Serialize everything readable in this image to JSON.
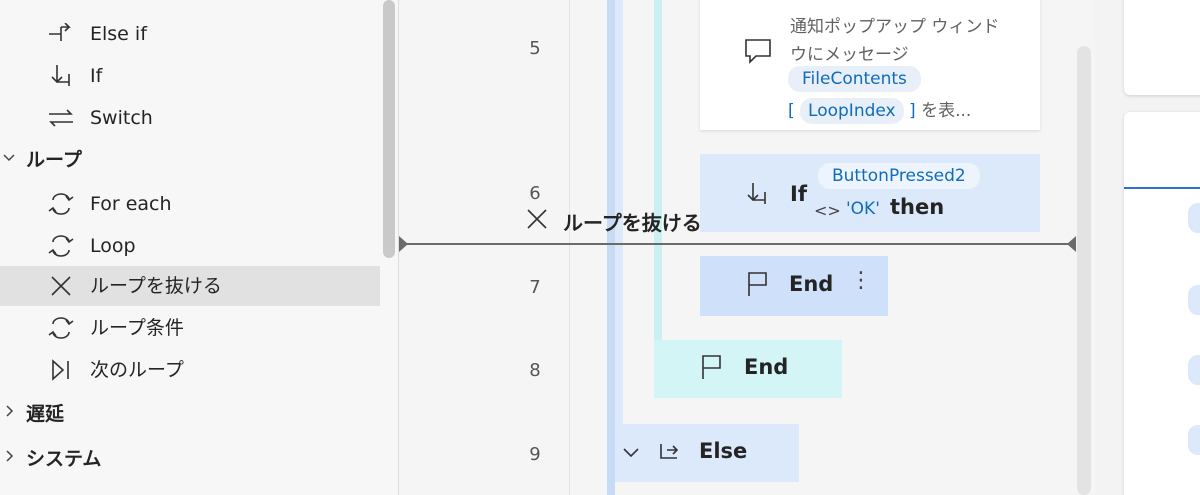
{
  "actions_panel": {
    "items": [
      {
        "label": "Else if",
        "icon": "else-if-icon"
      },
      {
        "label": "If",
        "icon": "if-icon"
      },
      {
        "label": "Switch",
        "icon": "switch-icon"
      }
    ],
    "groups": [
      {
        "label": "ループ",
        "expanded": true
      },
      {
        "label": "遅延",
        "expanded": false
      },
      {
        "label": "システム",
        "expanded": false
      }
    ],
    "loop_items": [
      {
        "label": "For each",
        "icon": "for-each-icon"
      },
      {
        "label": "Loop",
        "icon": "loop-icon"
      },
      {
        "label": "ループを抜ける",
        "icon": "exit-loop-icon",
        "selected": true
      },
      {
        "label": "ループ条件",
        "icon": "loop-condition-icon"
      },
      {
        "label": "次のループ",
        "icon": "next-loop-icon"
      }
    ]
  },
  "flow": {
    "line_numbers": [
      "5",
      "6",
      "7",
      "8",
      "9"
    ],
    "steps": {
      "message": {
        "line1": "通知ポップアップ ウィンド",
        "line2": "ウにメッセージ",
        "token1": "FileContents",
        "bracket_open": "[",
        "token2": "LoopIndex",
        "bracket_close": "]",
        "suffix": "を表..."
      },
      "if": {
        "keyword": "If",
        "var": "ButtonPressed2",
        "operator": "<>",
        "value": "'OK'",
        "then": "then"
      },
      "end_inner": {
        "keyword": "End",
        "more": "⋮"
      },
      "end_outer": {
        "keyword": "End"
      },
      "else": {
        "keyword": "Else"
      }
    },
    "drag_ghost": {
      "label": "ループを抜ける"
    }
  },
  "colors": {
    "if_block": "#dce9fb",
    "end_inner": "#cfe0fa",
    "end_outer": "#d4f5f5",
    "else_block": "#dce9fb",
    "rail_blue": "#c7dbf7",
    "rail_cyan": "#c9f1f1",
    "accent": "#0f6cbd"
  }
}
